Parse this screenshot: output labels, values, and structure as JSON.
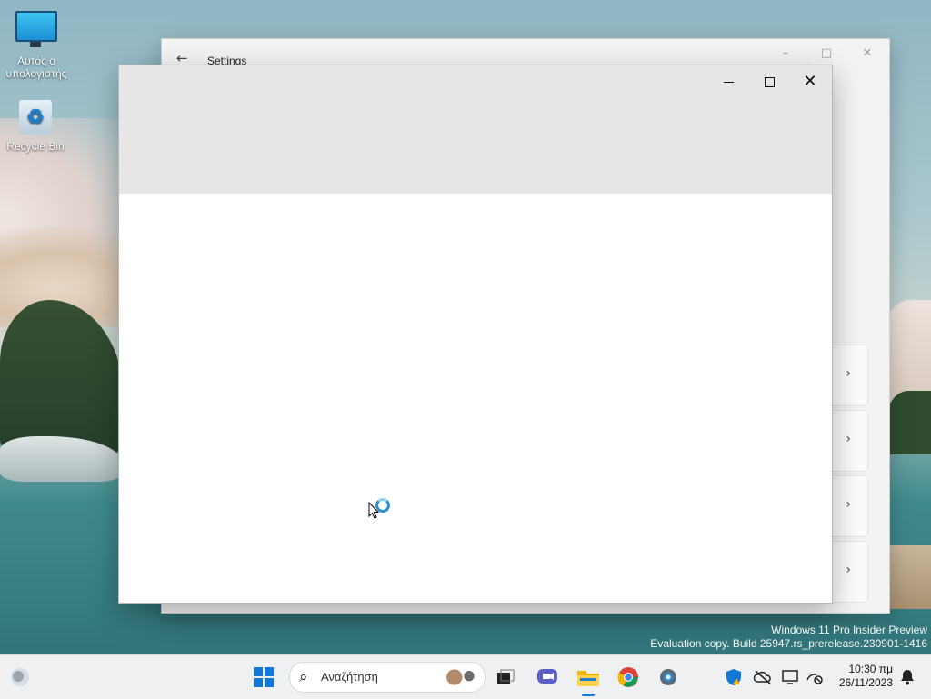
{
  "desktop": {
    "icons": [
      {
        "label": "Αυτός ο υπολογιστής",
        "icon": "monitor-icon"
      },
      {
        "label": "Recycle Bin",
        "icon": "recycle-bin-icon"
      }
    ]
  },
  "settings_window": {
    "title": "Settings",
    "back_icon": "back-arrow-icon",
    "controls": {
      "minimize": "–",
      "maximize": "□",
      "close": "✕"
    },
    "cards_count_visible": 4
  },
  "front_window": {
    "controls": {
      "minimize": "minimize-icon",
      "maximize": "maximize-icon",
      "close": "✕"
    },
    "state": "blank / loading"
  },
  "watermark": {
    "line1": "Windows 11 Pro Insider Preview",
    "line2": "Evaluation copy. Build 25947.rs_prerelease.230901-1416"
  },
  "taskbar": {
    "search_placeholder": "Αναζήτηση",
    "pinned": [
      "start-icon",
      "search-box",
      "task-view-icon",
      "teams-chat-icon",
      "file-explorer-icon",
      "chrome-icon",
      "settings-gear-icon"
    ],
    "tray": {
      "time": "10:30 πμ",
      "date": "26/11/2023"
    }
  },
  "colors": {
    "accent": "#1177d8",
    "taskbar_bg": "#eef0f2",
    "window_title_bg": "#e6e6e6"
  }
}
